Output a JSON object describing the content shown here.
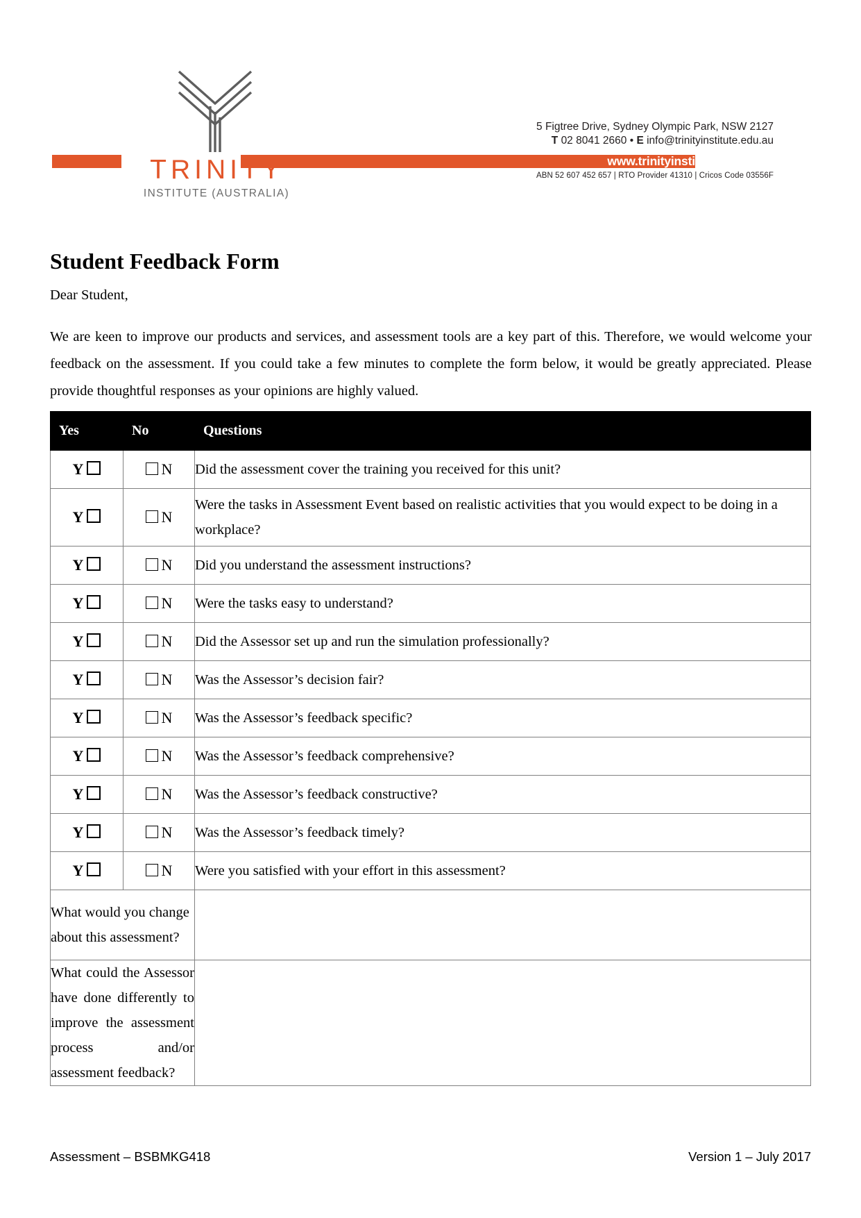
{
  "header": {
    "logo_word": "TRINITY",
    "logo_sub": "INSTITUTE (AUSTRALIA)",
    "address": "5 Figtree Drive, Sydney Olympic Park, NSW 2127",
    "phone_label": "T",
    "phone": "02 8041 2660",
    "separator": "•",
    "email_label": "E",
    "email": "info@trinityinstitute.edu.au",
    "website": "www.trinityinstitute.edu.au",
    "abn": "ABN 52 607 452 657 | RTO Provider 41310 | Cricos Code 03556F",
    "accent_color": "#E2562A"
  },
  "document": {
    "title": "Student Feedback Form",
    "salutation": "Dear Student,",
    "paragraph": "We are keen to improve our products and services, and assessment tools are a key part of this. Therefore, we would welcome your feedback on the assessment. If you could take a few minutes to complete the form below, it would be greatly appreciated. Please provide thoughtful responses as your opinions are highly valued."
  },
  "table": {
    "headers": [
      "Yes",
      "No",
      "Questions"
    ],
    "yes_mark": "Y",
    "no_mark": "N",
    "rows": [
      {
        "question": "Did the assessment cover the training you received for this unit?",
        "lines": 1
      },
      {
        "question": "Were the tasks in Assessment Event based on realistic activities that you would expect to be doing in a workplace?",
        "lines": 2
      },
      {
        "question": "Did you understand the assessment instructions?",
        "lines": 1
      },
      {
        "question": "Were the tasks easy to understand?",
        "lines": 1
      },
      {
        "question": "Did the Assessor set up and run the simulation professionally?",
        "lines": 1
      },
      {
        "question": "Was the Assessor’s decision fair?",
        "lines": 1
      },
      {
        "question": "Was the Assessor’s feedback specific?",
        "lines": 1
      },
      {
        "question": "Was the Assessor’s feedback comprehensive?",
        "lines": 1
      },
      {
        "question": "Was the Assessor’s feedback constructive?",
        "lines": 1
      },
      {
        "question": "Was the Assessor’s feedback timely?",
        "lines": 1
      },
      {
        "question": "Were you satisfied with your effort in this assessment?",
        "lines": 1
      }
    ],
    "open_questions": [
      {
        "label": "What would you change about this assessment?",
        "answer": ""
      },
      {
        "label": "What could the Assessor have done differently to improve the assessment process and/or assessment feedback?",
        "answer": ""
      }
    ]
  },
  "footer": {
    "left": "Assessment – BSBMKG418",
    "right": "Version 1 – July 2017"
  }
}
